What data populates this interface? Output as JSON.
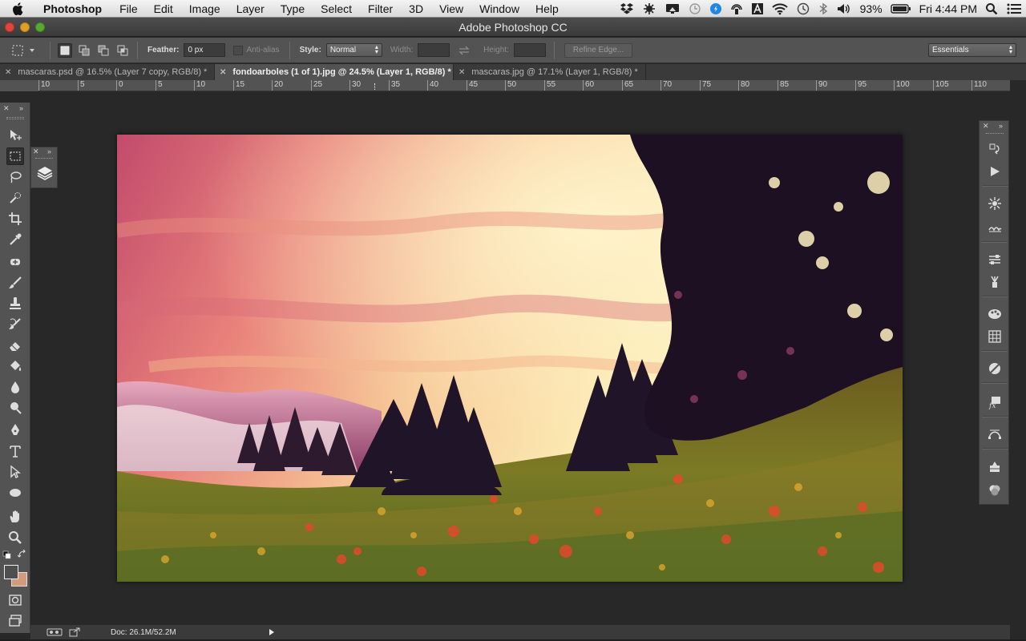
{
  "menubar": {
    "apple_icon": "apple-icon",
    "app_name": "Photoshop",
    "items": [
      "File",
      "Edit",
      "Image",
      "Layer",
      "Type",
      "Select",
      "Filter",
      "3D",
      "View",
      "Window",
      "Help"
    ],
    "status": {
      "battery": "93%",
      "clock": "Fri 4:44 PM"
    }
  },
  "window": {
    "title": "Adobe Photoshop CC"
  },
  "options": {
    "feather_label": "Feather:",
    "feather_value": "0 px",
    "antialias_label": "Anti-alias",
    "style_label": "Style:",
    "style_value": "Normal",
    "width_label": "Width:",
    "height_label": "Height:",
    "refine_edge": "Refine Edge...",
    "workspace": "Essentials"
  },
  "tabs": [
    {
      "label": "mascaras.psd @ 16.5% (Layer 7 copy, RGB/8) *",
      "active": false
    },
    {
      "label": "fondoarboles (1 of 1).jpg @ 24.5% (Layer 1, RGB/8) *",
      "active": true
    },
    {
      "label": "mascaras.jpg @ 17.1% (Layer 1, RGB/8) *",
      "active": false
    }
  ],
  "ruler": {
    "labels": [
      "10",
      "5",
      "0",
      "5",
      "10",
      "15",
      "20",
      "25",
      "30",
      "35",
      "40",
      "45",
      "50",
      "55",
      "60",
      "65",
      "70",
      "75",
      "80",
      "85",
      "90",
      "95",
      "100",
      "105",
      "110"
    ]
  },
  "statusbar": {
    "doc": "Doc: 26.1M/52.2M"
  },
  "colors": {
    "foreground": "#4f4f4f",
    "background": "#d49a7c"
  }
}
